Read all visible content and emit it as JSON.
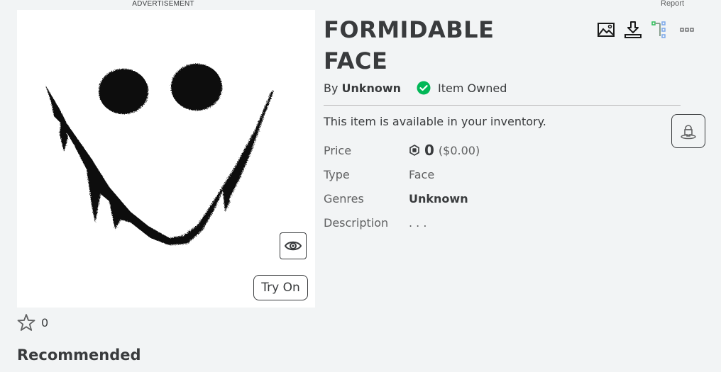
{
  "ad": {
    "label": "ADVERTISEMENT"
  },
  "report": {
    "label": "Report"
  },
  "item": {
    "title": "FORMIDABLE FACE",
    "by_label": "By",
    "creator": "Unknown",
    "owned_label": "Item Owned",
    "availability": "This item is available in your inventory.",
    "thumbnail_alt": "Formidable Face"
  },
  "details": {
    "price": {
      "label": "Price",
      "icon": "robux-icon",
      "amount": "0",
      "usd": "($0.00)"
    },
    "type": {
      "label": "Type",
      "value": "Face"
    },
    "genres": {
      "label": "Genres",
      "value": "Unknown"
    },
    "description": {
      "label": "Description",
      "value": ". . ."
    }
  },
  "toolbar": {
    "icons": [
      "image-icon",
      "download-icon",
      "hierarchy-icon",
      "more-icon"
    ]
  },
  "thumbnail_controls": {
    "view_icon": "eye-icon",
    "try_on_label": "Try On"
  },
  "favorites": {
    "icon": "star-icon",
    "count": "0"
  },
  "sections": {
    "recommended": "Recommended"
  },
  "colors": {
    "background": "#f2f4f5",
    "text_primary": "#393b3d",
    "text_secondary": "#606162",
    "owned_green": "#02b757",
    "hierarchy_green": "#2ebf5a",
    "hierarchy_blue": "#7aa7ea"
  }
}
